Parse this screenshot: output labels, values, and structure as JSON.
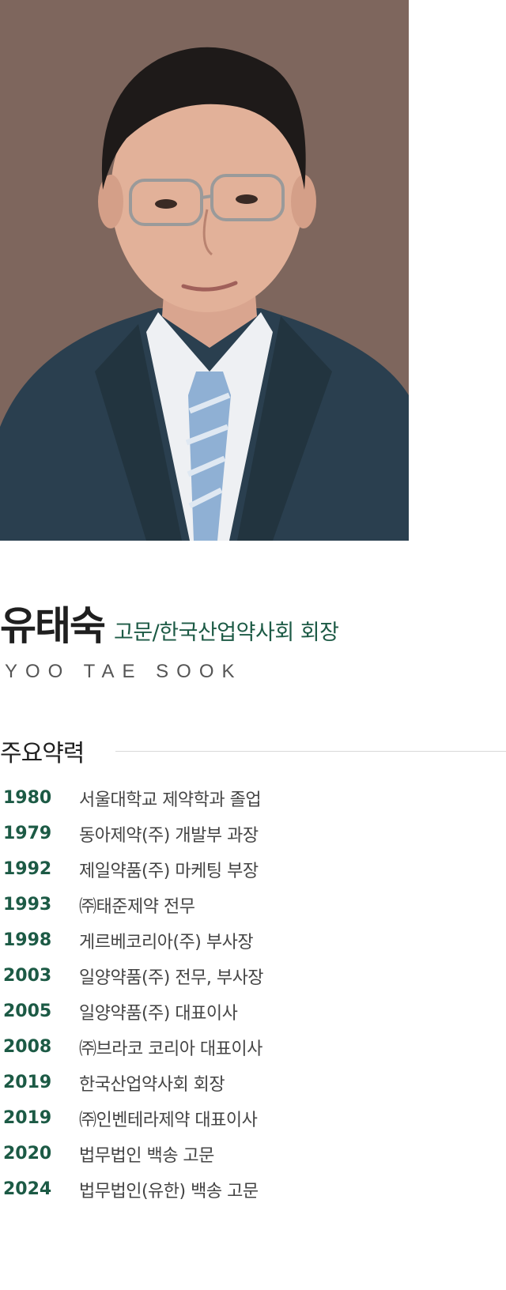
{
  "profile": {
    "photo_icon": "portrait-photo",
    "photo_background": "#7e665d",
    "name_ko": "유태숙",
    "title_ko": "고문/한국산업약사회 회장",
    "name_en": "YOO TAE SOOK"
  },
  "career": {
    "heading": "주요약력",
    "accent_color": "#1c5a45",
    "items": [
      {
        "year": "1980",
        "text": "서울대학교 제약학과 졸업"
      },
      {
        "year": "1979",
        "text": "동아제약(주) 개발부 과장"
      },
      {
        "year": "1992",
        "text": "제일약품(주) 마케팅 부장"
      },
      {
        "year": "1993",
        "text": "㈜태준제약 전무"
      },
      {
        "year": "1998",
        "text": "게르베코리아(주) 부사장"
      },
      {
        "year": "2003",
        "text": "일양약품(주) 전무, 부사장"
      },
      {
        "year": "2005",
        "text": "일양약품(주) 대표이사"
      },
      {
        "year": "2008",
        "text": "㈜브라코 코리아 대표이사"
      },
      {
        "year": "2019",
        "text": "한국산업약사회 회장"
      },
      {
        "year": "2019",
        "text": "㈜인벤테라제약 대표이사"
      },
      {
        "year": "2020",
        "text": "법무법인 백송 고문"
      },
      {
        "year": "2024",
        "text": "법무법인(유한) 백송 고문"
      }
    ]
  }
}
